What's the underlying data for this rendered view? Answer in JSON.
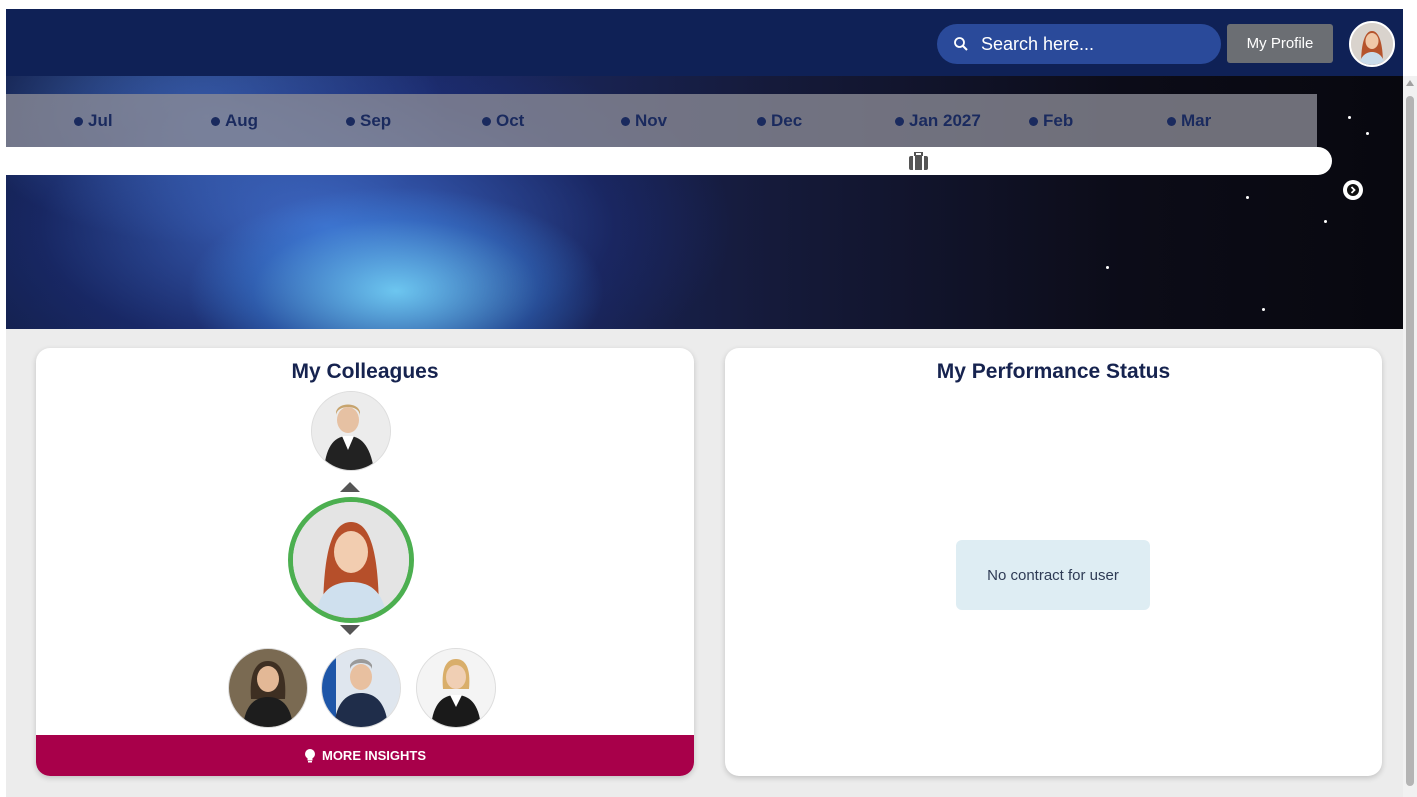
{
  "header": {
    "search": {
      "placeholder": "Search here...",
      "icon": "search-icon"
    },
    "profile_button_label": "My Profile",
    "avatar_icon": "user-avatar"
  },
  "timeline": {
    "months": [
      {
        "label": "Jul"
      },
      {
        "label": "Aug"
      },
      {
        "label": "Sep"
      },
      {
        "label": "Oct"
      },
      {
        "label": "Nov"
      },
      {
        "label": "Dec"
      },
      {
        "label": "Jan 2027"
      },
      {
        "label": "Feb"
      },
      {
        "label": "Mar"
      }
    ],
    "track_icon": "briefcase-icon",
    "next_icon": "chevron-right-icon"
  },
  "colleagues": {
    "title": "My Colleagues",
    "more_insights_label": "MORE INSIGHTS",
    "more_insights_icon": "lightbulb-icon",
    "selected_ring_color": "#4caf50"
  },
  "performance": {
    "title": "My Performance Status",
    "message": "No contract for user"
  },
  "colors": {
    "header_bg": "#0f2156",
    "search_bg": "#2a4a9a",
    "profile_button_bg": "#6b6e73",
    "insights_button_bg": "#a8004a",
    "notice_bg": "#deedf3"
  }
}
